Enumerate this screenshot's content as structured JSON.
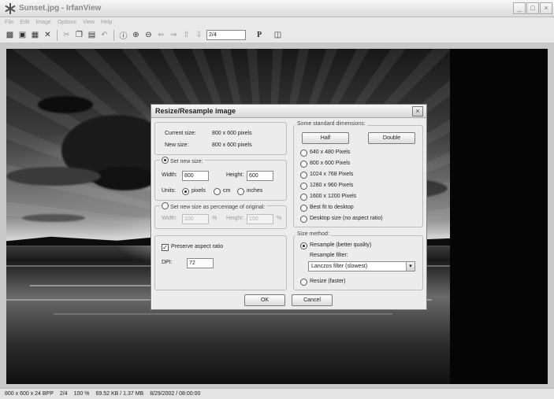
{
  "window": {
    "title": "Sunset.jpg - IrfanView"
  },
  "menu": [
    "File",
    "Edit",
    "Image",
    "Options",
    "View",
    "Help"
  ],
  "toolbar": {
    "page_value": "2/4",
    "p_label": "P"
  },
  "status": {
    "dimensions": "800 x 600 x 24 BPP",
    "page": "2/4",
    "zoom": "100 %",
    "size": "69.52 KB / 1.37 MB",
    "date": "8/29/2002 / 08:00:00"
  },
  "dialog": {
    "title": "Resize/Resample image",
    "current_size_label": "Current size:",
    "current_size_value": "800  x  600  pixels",
    "new_size_label": "New size:",
    "new_size_value": "800  x  600  pixels",
    "set_new_size_label": "Set new size:",
    "width_label": "Width:",
    "width_value": "800",
    "height_label": "Height:",
    "height_value": "600",
    "units_label": "Units:",
    "units": [
      "pixels",
      "cm",
      "inches"
    ],
    "percent_label": "Set new size as percentage of original:",
    "pct_width_label": "Width:",
    "pct_width_value": "100",
    "pct_height_label": "Height:",
    "pct_height_value": "100",
    "pct_sign": "%",
    "preserve_label": "Preserve aspect ratio",
    "dpi_label": "DPI:",
    "dpi_value": "72",
    "standard_label": "Some standard dimensions:",
    "half_label": "Half",
    "double_label": "Double",
    "standard_options": [
      "640 x 480 Pixels",
      "800 x 600 Pixels",
      "1024 x 768 Pixels",
      "1280 x 960 Pixels",
      "1600 x 1200 Pixels",
      "Best fit to desktop",
      "Desktop size (no aspect ratio)"
    ],
    "size_method_label": "Size method:",
    "resample_label": "Resample (better quality)",
    "resample_filter_label": "Resample filter:",
    "filter_value": "Lanczos filter (slowest)",
    "resize_label": "Resize (faster)",
    "ok_label": "OK",
    "cancel_label": "Cancel"
  }
}
